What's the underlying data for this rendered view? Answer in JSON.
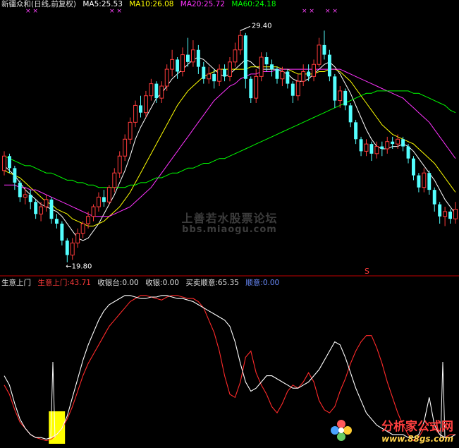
{
  "main_header": {
    "name": "新疆众和(日线,前复权)",
    "ma5": "MA5:25.53",
    "ma10": "MA10:26.08",
    "ma20": "MA20:25.72",
    "ma60": "MA60:24.18"
  },
  "sub_header": {
    "name": "生意上门",
    "sy": "生意上门:43.71",
    "shouyin_tai": "收银台:0.00",
    "shouyin": "收银:0.00",
    "maimai": "买卖顺意:65.35",
    "shunyi": "顺意:0.00"
  },
  "annotations": {
    "high_label": "29.40",
    "low_label": "19.80",
    "s_mark": "S",
    "cross_mark": "× ×"
  },
  "watermark": {
    "line1": "上善若水股票论坛",
    "line2": "bbs.miaogu.com"
  },
  "logo": {
    "name": "分析家公式网",
    "url": "www.88gs.com"
  },
  "colors": {
    "up": "#ff3b3b",
    "down": "#54ffff",
    "ma5": "#ffffff",
    "ma10": "#ffff00",
    "ma20": "#ff33ff",
    "ma60": "#00ff00",
    "sy_red": "#ff2a2a",
    "white_line": "#ffffff",
    "bar": "#ffff00",
    "divider": "#c00000",
    "crosses": "#ff44ff"
  },
  "chart_data": [
    {
      "type": "candlestick",
      "ylim": [
        19.5,
        30.2
      ],
      "high_mark": 29.4,
      "low_mark": 19.8,
      "candles": [
        [
          23.6,
          24.2,
          24.4,
          23.4
        ],
        [
          24.2,
          23.7,
          24.3,
          23.5
        ],
        [
          23.7,
          23.1,
          23.8,
          22.8
        ],
        [
          23.1,
          22.5,
          23.2,
          22.3
        ],
        [
          22.5,
          22.6,
          22.9,
          22.2
        ],
        [
          22.6,
          22.3,
          22.8,
          22.0
        ],
        [
          22.3,
          21.8,
          22.4,
          21.6
        ],
        [
          21.8,
          22.1,
          22.3,
          21.5
        ],
        [
          22.1,
          22.4,
          22.6,
          21.9
        ],
        [
          22.4,
          21.6,
          22.5,
          21.4
        ],
        [
          21.6,
          21.4,
          21.8,
          21.2
        ],
        [
          21.4,
          20.7,
          21.5,
          20.5
        ],
        [
          20.7,
          20.1,
          20.8,
          19.8
        ],
        [
          20.1,
          20.6,
          20.8,
          19.9
        ],
        [
          20.6,
          21.0,
          21.2,
          20.4
        ],
        [
          21.0,
          21.4,
          21.5,
          20.8
        ],
        [
          21.4,
          21.7,
          21.9,
          21.2
        ],
        [
          21.7,
          22.1,
          22.2,
          21.5
        ],
        [
          22.1,
          22.5,
          22.7,
          21.9
        ],
        [
          22.5,
          22.3,
          22.8,
          22.1
        ],
        [
          22.3,
          22.9,
          23.0,
          22.2
        ],
        [
          22.9,
          23.5,
          23.7,
          22.7
        ],
        [
          23.5,
          24.2,
          24.4,
          23.3
        ],
        [
          24.2,
          24.9,
          25.1,
          24.0
        ],
        [
          24.9,
          25.6,
          25.8,
          24.7
        ],
        [
          25.6,
          26.3,
          26.5,
          25.4
        ],
        [
          26.3,
          26.0,
          26.7,
          25.8
        ],
        [
          26.0,
          26.7,
          26.9,
          25.8
        ],
        [
          26.7,
          27.2,
          27.4,
          26.5
        ],
        [
          27.2,
          26.6,
          27.3,
          26.4
        ],
        [
          26.6,
          27.1,
          27.3,
          26.4
        ],
        [
          27.1,
          27.8,
          28.0,
          26.9
        ],
        [
          27.8,
          28.2,
          28.6,
          27.5
        ],
        [
          28.2,
          27.7,
          28.3,
          27.4
        ],
        [
          27.7,
          28.4,
          28.7,
          27.5
        ],
        [
          28.4,
          28.1,
          29.1,
          27.9
        ],
        [
          28.1,
          28.6,
          29.0,
          27.9
        ],
        [
          28.6,
          27.9,
          28.8,
          27.6
        ],
        [
          27.9,
          27.4,
          28.1,
          27.2
        ],
        [
          27.4,
          27.6,
          27.9,
          27.2
        ],
        [
          27.6,
          27.3,
          27.8,
          27.0
        ],
        [
          27.3,
          27.8,
          28.0,
          27.1
        ],
        [
          27.8,
          27.5,
          28.0,
          27.3
        ],
        [
          27.5,
          28.1,
          28.3,
          27.3
        ],
        [
          28.1,
          28.6,
          28.9,
          27.9
        ],
        [
          28.6,
          29.2,
          29.4,
          28.4
        ],
        [
          29.2,
          27.4,
          29.3,
          27.0
        ],
        [
          27.4,
          26.6,
          27.5,
          26.4
        ],
        [
          26.6,
          27.5,
          27.8,
          26.4
        ],
        [
          27.5,
          28.3,
          28.5,
          27.3
        ],
        [
          28.3,
          28.0,
          28.5,
          27.7
        ],
        [
          28.0,
          27.8,
          28.2,
          27.5
        ],
        [
          27.8,
          27.4,
          27.9,
          27.2
        ],
        [
          27.4,
          27.7,
          27.9,
          27.1
        ],
        [
          27.7,
          27.2,
          27.8,
          27.0
        ],
        [
          27.2,
          26.7,
          27.3,
          26.4
        ],
        [
          26.7,
          27.3,
          27.6,
          26.5
        ],
        [
          27.3,
          27.7,
          28.0,
          27.1
        ],
        [
          27.7,
          27.5,
          28.0,
          27.3
        ],
        [
          27.5,
          28.0,
          28.2,
          27.3
        ],
        [
          28.0,
          28.8,
          29.1,
          27.9
        ],
        [
          28.8,
          28.4,
          29.4,
          28.2
        ],
        [
          28.4,
          27.5,
          28.6,
          27.3
        ],
        [
          27.5,
          26.5,
          27.6,
          26.2
        ],
        [
          26.5,
          26.9,
          27.1,
          26.2
        ],
        [
          26.9,
          26.3,
          27.0,
          26.1
        ],
        [
          26.3,
          25.6,
          26.4,
          25.4
        ],
        [
          25.6,
          24.9,
          25.7,
          24.7
        ],
        [
          24.9,
          24.4,
          25.0,
          24.2
        ],
        [
          24.4,
          24.7,
          24.9,
          24.2
        ],
        [
          24.7,
          24.3,
          24.8,
          24.0
        ],
        [
          24.3,
          24.6,
          24.8,
          24.1
        ],
        [
          24.6,
          24.5,
          24.8,
          24.2
        ],
        [
          24.5,
          24.8,
          25.0,
          24.3
        ],
        [
          24.8,
          24.7,
          25.0,
          24.5
        ],
        [
          24.7,
          24.9,
          25.1,
          24.5
        ],
        [
          24.9,
          24.6,
          25.0,
          24.4
        ],
        [
          24.6,
          24.1,
          24.7,
          23.9
        ],
        [
          24.1,
          23.4,
          24.2,
          23.2
        ],
        [
          23.4,
          22.9,
          23.5,
          22.7
        ],
        [
          22.9,
          23.5,
          23.7,
          22.7
        ],
        [
          23.5,
          22.8,
          23.6,
          22.6
        ],
        [
          22.8,
          22.2,
          22.9,
          21.9
        ],
        [
          22.2,
          21.7,
          22.3,
          21.4
        ],
        [
          21.7,
          21.9,
          22.1,
          21.3
        ],
        [
          21.9,
          21.6,
          22.0,
          21.4
        ],
        [
          21.6,
          22.0,
          22.3,
          21.4
        ]
      ],
      "series": [
        {
          "name": "MA5",
          "values": [
            23.8,
            23.6,
            23.4,
            23.1,
            22.8,
            22.6,
            22.4,
            22.2,
            22.1,
            22.0,
            21.9,
            21.7,
            21.4,
            21.1,
            20.8,
            20.7,
            20.8,
            21.1,
            21.4,
            21.8,
            22.2,
            22.6,
            23.1,
            23.6,
            24.2,
            24.9,
            25.4,
            25.8,
            26.2,
            26.6,
            26.8,
            27.1,
            27.4,
            27.6,
            27.8,
            28.0,
            28.2,
            28.3,
            28.2,
            28.0,
            27.8,
            27.6,
            27.5,
            27.6,
            27.8,
            28.0,
            28.2,
            28.1,
            27.9,
            27.8,
            27.8,
            27.8,
            27.8,
            27.7,
            27.6,
            27.4,
            27.3,
            27.3,
            27.4,
            27.6,
            27.8,
            28.0,
            28.1,
            27.9,
            27.6,
            27.2,
            26.8,
            26.3,
            25.8,
            25.3,
            24.9,
            24.6,
            24.5,
            24.5,
            24.6,
            24.6,
            24.7,
            24.6,
            24.4,
            24.1,
            23.8,
            23.5,
            23.2,
            22.8,
            22.4,
            22.1,
            21.8
          ]
        },
        {
          "name": "MA10",
          "values": [
            23.6,
            23.5,
            23.4,
            23.3,
            23.1,
            22.9,
            22.7,
            22.5,
            22.3,
            22.2,
            22.0,
            21.9,
            21.8,
            21.6,
            21.5,
            21.4,
            21.3,
            21.3,
            21.4,
            21.5,
            21.7,
            21.9,
            22.1,
            22.4,
            22.7,
            23.1,
            23.5,
            23.9,
            24.3,
            24.7,
            25.1,
            25.5,
            25.9,
            26.3,
            26.6,
            26.9,
            27.1,
            27.3,
            27.5,
            27.6,
            27.7,
            27.8,
            27.8,
            27.8,
            27.8,
            27.8,
            27.8,
            27.9,
            27.9,
            27.9,
            27.9,
            27.9,
            27.9,
            27.8,
            27.8,
            27.7,
            27.6,
            27.6,
            27.6,
            27.6,
            27.7,
            27.7,
            27.8,
            27.8,
            27.7,
            27.5,
            27.3,
            27.0,
            26.7,
            26.4,
            26.1,
            25.8,
            25.5,
            25.3,
            25.1,
            25.0,
            24.9,
            24.8,
            24.7,
            24.5,
            24.3,
            24.1,
            23.9,
            23.6,
            23.3,
            23.0,
            22.7
          ]
        },
        {
          "name": "MA20",
          "values": [
            23.0,
            23.0,
            23.0,
            22.9,
            22.9,
            22.8,
            22.8,
            22.7,
            22.6,
            22.5,
            22.4,
            22.3,
            22.2,
            22.1,
            22.0,
            21.9,
            21.8,
            21.7,
            21.7,
            21.7,
            21.7,
            21.8,
            21.9,
            22.0,
            22.1,
            22.3,
            22.5,
            22.7,
            22.9,
            23.2,
            23.5,
            23.8,
            24.1,
            24.4,
            24.7,
            25.0,
            25.3,
            25.6,
            25.9,
            26.2,
            26.5,
            26.7,
            26.9,
            27.1,
            27.2,
            27.4,
            27.5,
            27.6,
            27.6,
            27.7,
            27.7,
            27.7,
            27.8,
            27.8,
            27.8,
            27.8,
            27.8,
            27.8,
            27.8,
            27.8,
            27.8,
            27.8,
            27.8,
            27.8,
            27.8,
            27.7,
            27.6,
            27.5,
            27.4,
            27.3,
            27.2,
            27.1,
            27.0,
            26.9,
            26.8,
            26.7,
            26.6,
            26.4,
            26.2,
            26.0,
            25.8,
            25.6,
            25.3,
            25.0,
            24.7,
            24.4,
            24.1
          ]
        },
        {
          "name": "MA60",
          "values": [
            24.2,
            24.1,
            24.0,
            23.9,
            23.8,
            23.8,
            23.7,
            23.6,
            23.5,
            23.5,
            23.4,
            23.3,
            23.2,
            23.2,
            23.1,
            23.1,
            23.0,
            23.0,
            22.9,
            22.9,
            22.9,
            22.9,
            22.9,
            22.9,
            23.0,
            23.0,
            23.1,
            23.1,
            23.2,
            23.3,
            23.3,
            23.4,
            23.5,
            23.5,
            23.6,
            23.7,
            23.7,
            23.8,
            23.9,
            23.9,
            24.0,
            24.1,
            24.1,
            24.2,
            24.3,
            24.4,
            24.5,
            24.6,
            24.7,
            24.8,
            24.9,
            25.0,
            25.1,
            25.2,
            25.3,
            25.4,
            25.5,
            25.6,
            25.7,
            25.8,
            25.9,
            26.0,
            26.1,
            26.2,
            26.3,
            26.4,
            26.5,
            26.6,
            26.7,
            26.8,
            26.8,
            26.9,
            26.9,
            26.9,
            26.9,
            26.9,
            26.9,
            26.9,
            26.8,
            26.8,
            26.7,
            26.6,
            26.5,
            26.4,
            26.3,
            26.1,
            26.0
          ]
        }
      ]
    },
    {
      "type": "line",
      "ylim": [
        0,
        100
      ],
      "series": [
        {
          "name": "生意上门",
          "values": [
            38,
            32,
            22,
            14,
            10,
            6,
            4,
            3,
            2,
            3,
            6,
            10,
            16,
            24,
            34,
            44,
            52,
            58,
            64,
            70,
            76,
            80,
            84,
            88,
            92,
            94,
            96,
            96,
            95,
            94,
            93,
            95,
            96,
            96,
            95,
            94,
            94,
            92,
            88,
            80,
            72,
            60,
            44,
            32,
            30,
            40,
            56,
            60,
            46,
            38,
            32,
            24,
            20,
            26,
            34,
            38,
            36,
            40,
            46,
            40,
            28,
            22,
            20,
            24,
            34,
            42,
            52,
            60,
            66,
            70,
            70,
            62,
            52,
            40,
            30,
            20,
            12,
            6,
            2,
            4,
            10,
            14,
            10,
            6,
            4,
            6,
            6
          ]
        },
        {
          "name": "买卖顺意",
          "values": [
            44,
            38,
            26,
            16,
            10,
            6,
            4,
            4,
            3,
            4,
            6,
            10,
            18,
            30,
            42,
            54,
            64,
            72,
            80,
            86,
            90,
            92,
            94,
            96,
            96,
            95,
            94,
            94,
            95,
            95,
            96,
            96,
            95,
            94,
            94,
            93,
            92,
            90,
            88,
            86,
            84,
            82,
            80,
            76,
            66,
            52,
            40,
            34,
            36,
            40,
            44,
            44,
            42,
            40,
            38,
            36,
            36,
            38,
            40,
            44,
            48,
            54,
            60,
            66,
            64,
            56,
            46,
            36,
            28,
            20,
            16,
            12,
            10,
            8,
            6,
            6,
            6,
            4,
            4,
            6,
            14,
            30,
            12,
            6,
            4,
            4,
            6
          ]
        },
        {
          "name": "收银台",
          "values": [
            0,
            0,
            0,
            0,
            0,
            0,
            0,
            0,
            0,
            8,
            8,
            8,
            0,
            0,
            0,
            0,
            0,
            0,
            0,
            0,
            0,
            0,
            0,
            0,
            0,
            0,
            0,
            0,
            0,
            0,
            0,
            0,
            0,
            0,
            0,
            0,
            0,
            0,
            0,
            0,
            0,
            0,
            0,
            0,
            0,
            0,
            0,
            0,
            0,
            0,
            0,
            0,
            0,
            0,
            0,
            0,
            0,
            0,
            0,
            0,
            0,
            0,
            0,
            0,
            0,
            0,
            0,
            0,
            0,
            0,
            0,
            0,
            0,
            0,
            0,
            0,
            0,
            0,
            0,
            0,
            0,
            0,
            0,
            0,
            0,
            0,
            0
          ]
        }
      ]
    }
  ]
}
